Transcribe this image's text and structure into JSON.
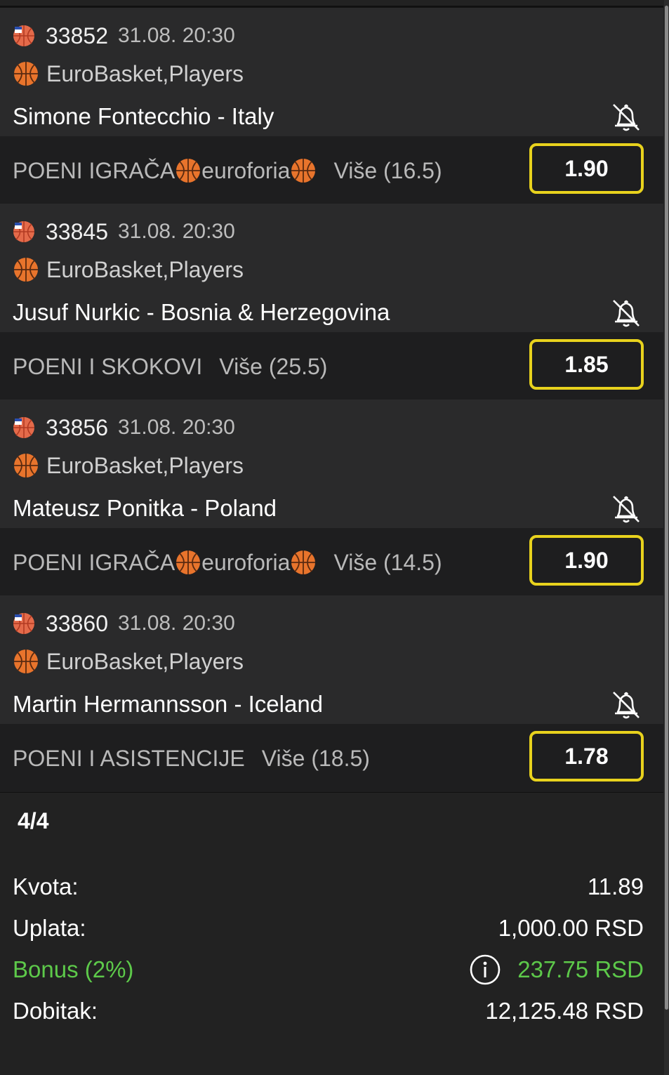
{
  "tickets": [
    {
      "event_id": "33852",
      "time": "31.08. 20:30",
      "league": "EuroBasket,Players",
      "player": "Simone Fontecchio - Italy",
      "market_parts": [
        "POENI IGRAČA ",
        "euroforia",
        ""
      ],
      "market_has_balls": true,
      "selection": "Više (16.5)",
      "odd": "1.90"
    },
    {
      "event_id": "33845",
      "time": "31.08. 20:30",
      "league": "EuroBasket,Players",
      "player": "Jusuf Nurkic - Bosnia & Herzegovina",
      "market_parts": [
        "POENI I SKOKOVI",
        "",
        ""
      ],
      "market_has_balls": false,
      "selection": "Više (25.5)",
      "odd": "1.85"
    },
    {
      "event_id": "33856",
      "time": "31.08. 20:30",
      "league": "EuroBasket,Players",
      "player": "Mateusz Ponitka - Poland",
      "market_parts": [
        "POENI IGRAČA ",
        "euroforia",
        ""
      ],
      "market_has_balls": true,
      "selection": "Više (14.5)",
      "odd": "1.90"
    },
    {
      "event_id": "33860",
      "time": "31.08. 20:30",
      "league": "EuroBasket,Players",
      "player": "Martin Hermannsson - Iceland",
      "market_parts": [
        "POENI I ASISTENCIJE",
        "",
        ""
      ],
      "market_has_balls": false,
      "selection": "Više (18.5)",
      "odd": "1.78"
    }
  ],
  "summary": {
    "count": "4/4",
    "kvota_label": "Kvota:",
    "kvota_value": "11.89",
    "uplata_label": "Uplata:",
    "uplata_value": "1,000.00 RSD",
    "bonus_label": "Bonus (2%)",
    "bonus_value": "237.75 RSD",
    "dobitak_label": "Dobitak:",
    "dobitak_value": "12,125.48 RSD"
  },
  "colors": {
    "accent_yellow": "#e8d21d",
    "bonus_green": "#5dc94a",
    "card_bg": "#2a2a2b",
    "market_bg": "#1e1e1f"
  },
  "icons": {
    "sport": "basketball-icon",
    "sport_flag": "basketball-flag-icon",
    "notify": "bell-off-icon",
    "info": "info-icon"
  }
}
